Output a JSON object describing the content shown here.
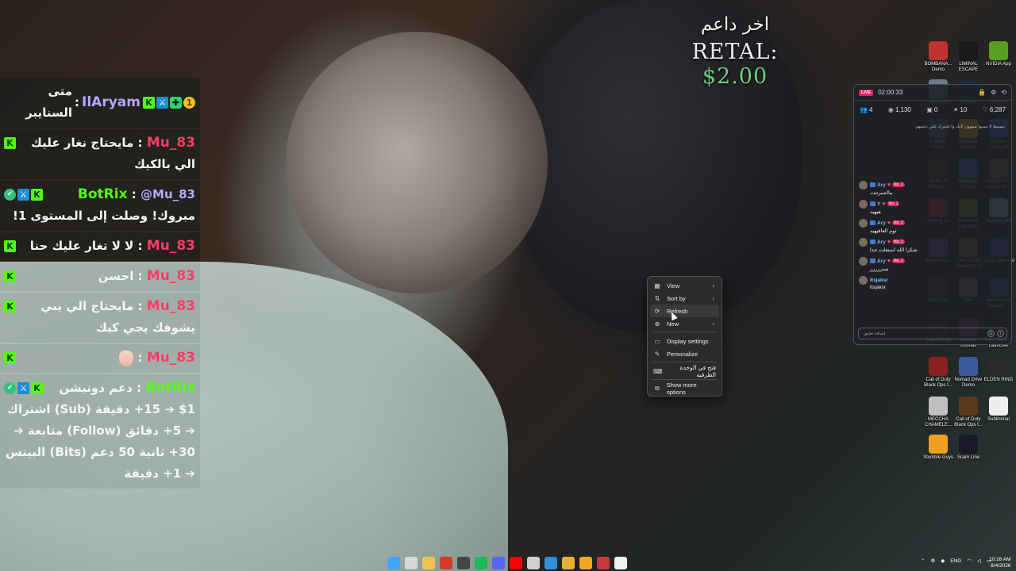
{
  "donation": {
    "title": "اخر داعم",
    "donor": "RETAL:",
    "amount": "$2.00"
  },
  "chat": {
    "messages": [
      {
        "user": "IlAryam",
        "text": "متى السنايبر"
      },
      {
        "user": "Mu_83",
        "text": "مايحتاج نغار عليك الي بالكيك"
      },
      {
        "user": "BotRix",
        "mention": "@Mu_83",
        "text": "مبروك! وصلت إلى المستوى 1!"
      },
      {
        "user": "Mu_83",
        "text": "لا لا تغار عليك حنا"
      },
      {
        "user": "Mu_83",
        "text": "احسن"
      },
      {
        "user": "Mu_83",
        "text": "مايحتاج الي يبي يشوفك يجي كيك"
      },
      {
        "user": "Mu_83",
        "text": ""
      },
      {
        "user": "BotRix",
        "text": "دعم دونيشن 1$ ➔ 15+ دقيقة (Sub) اشتراك ➔ 5+ دقائق (Follow) متابعة ➔ 30+ ثانية 50 دعم (Bits) البيتس ➔ 1+ دقيقة"
      }
    ]
  },
  "context_menu": {
    "items": [
      {
        "label": "View",
        "icon": "grid-icon",
        "submenu": true
      },
      {
        "label": "Sort by",
        "icon": "sort-icon",
        "submenu": true
      },
      {
        "label": "Refresh",
        "icon": "refresh-icon",
        "submenu": false
      },
      {
        "label": "New",
        "icon": "plus-circle-icon",
        "submenu": true
      },
      {
        "label": "Display settings",
        "icon": "display-icon",
        "submenu": false
      },
      {
        "label": "Personalize",
        "icon": "brush-icon",
        "submenu": false
      },
      {
        "label": "فتح في الوحدة الطرفية",
        "icon": "terminal-icon",
        "submenu": false
      },
      {
        "label": "Show more options",
        "icon": "more-options-icon",
        "submenu": false
      }
    ]
  },
  "stream_panel": {
    "live": "LIVE",
    "uptime": "02:00:33",
    "stats": {
      "chatters": "4",
      "viewers": "1,130",
      "gifts": "0",
      "subs": "10",
      "likes": "6,287"
    },
    "pinned_text": "تبسيط لا تنسوا تسوون لايك وا اشترك على دعمهم",
    "messages": [
      {
        "user": "Ary",
        "rank": "No. 2",
        "text": "مااصبرتتت"
      },
      {
        "user": "Y",
        "rank": "No. 1",
        "text": "هيهيه"
      },
      {
        "user": "Ary",
        "rank": "No. 2",
        "text": "ثوم العافيهيه"
      },
      {
        "user": "Ary",
        "rank": "No. 2",
        "text": "شكرا الله استعلت جدا"
      },
      {
        "user": "Ary",
        "rank": "No. 2",
        "text": "سبررررر"
      },
      {
        "user": "itsjaksr",
        "rank": "",
        "text": "itsjaksr"
      }
    ],
    "input_placeholder": "إضافة تعليق"
  },
  "desktop_icons": [
    {
      "label": "BOMBANA... Demo",
      "color": "#c0322f"
    },
    {
      "label": "LIMINAL ESCAPE",
      "color": "#1a1a1a"
    },
    {
      "label": "NVIDIA App",
      "color": "#5a9e1f"
    },
    {
      "label": "Cloudroom",
      "color": "#6b7c8c"
    },
    {
      "label": "Steam",
      "color": "#1b2838"
    },
    {
      "label": "TIKTOK WATCH",
      "color": "#222222"
    },
    {
      "label": "Friends Scotch",
      "color": "#4a5a7a"
    },
    {
      "label": "Rockstar Games",
      "color": "#f4b400"
    },
    {
      "label": "Rocket League®",
      "color": "#2f6fd0"
    },
    {
      "label": "Death At Midnigh...",
      "color": "#5a3a2a"
    },
    {
      "label": "Wallpaper Engine",
      "color": "#2a6fcf"
    },
    {
      "label": "UNCHART... Legacy of ...",
      "color": "#7a6a4a"
    },
    {
      "label": "Among Us",
      "color": "#c03030"
    },
    {
      "label": "Minecraft Launcher",
      "color": "#5b8c2a"
    },
    {
      "label": "Recycle Bin",
      "color": "#9cc7e8"
    },
    {
      "label": "Better-Cre...",
      "color": "#6a4fb0"
    },
    {
      "label": "Call of Duty Black Ops II",
      "color": "#8a6a3a"
    },
    {
      "label": "Topaz Video AI",
      "color": "#3a3ac0"
    },
    {
      "label": "MIMESIS",
      "color": "#444444"
    },
    {
      "label": "blvr",
      "color": "#777777"
    },
    {
      "label": "Backrooms Escape T...",
      "color": "#2a5a9a"
    },
    {
      "label": "Call of Duty",
      "color": "#333333"
    },
    {
      "label": "Bloody Gorillas",
      "color": "#7a3a6a"
    },
    {
      "label": "Epic Games Launcher",
      "color": "#222222"
    },
    {
      "label": "Call of Duty Black Ops I...",
      "color": "#8a2020"
    },
    {
      "label": "Nomad Drive Demo",
      "color": "#3a5aa0"
    },
    {
      "label": "ELDEN RING",
      "color": "#2a2a2a"
    },
    {
      "label": "MECCHA CHAMELE...",
      "color": "#c0c0c0"
    },
    {
      "label": "Call of Duty Black Ops I...",
      "color": "#5a3a1a"
    },
    {
      "label": "Subliminal",
      "color": "#eeeeee"
    },
    {
      "label": "Stumble Guys",
      "color": "#f0a020"
    },
    {
      "label": "Scam Line",
      "color": "#1a1a2a"
    }
  ],
  "taskbar": {
    "apps": [
      {
        "name": "windows-start-icon",
        "color": "#3fa6f5"
      },
      {
        "name": "search-icon",
        "color": "#d8d8d8"
      },
      {
        "name": "file-explorer-icon",
        "color": "#f2c14e"
      },
      {
        "name": "app-red-icon",
        "color": "#d23a2a"
      },
      {
        "name": "obs-icon",
        "color": "#444444"
      },
      {
        "name": "spotify-icon",
        "color": "#1db954"
      },
      {
        "name": "discord-icon",
        "color": "#5865f2"
      },
      {
        "name": "youtube-icon",
        "color": "#ff0000"
      },
      {
        "name": "chatgpt-icon",
        "color": "#d0d0d0"
      },
      {
        "name": "screen-icon",
        "color": "#2f8fd8"
      },
      {
        "name": "chrome-icon",
        "color": "#e8b22e"
      },
      {
        "name": "arc-icon",
        "color": "#f5a623"
      },
      {
        "name": "calendar-icon",
        "color": "#c53a3a"
      },
      {
        "name": "document-icon",
        "color": "#f0f0f0"
      }
    ],
    "lang": "ENG",
    "time": "10:16 AM",
    "date": "8/4/2026"
  }
}
